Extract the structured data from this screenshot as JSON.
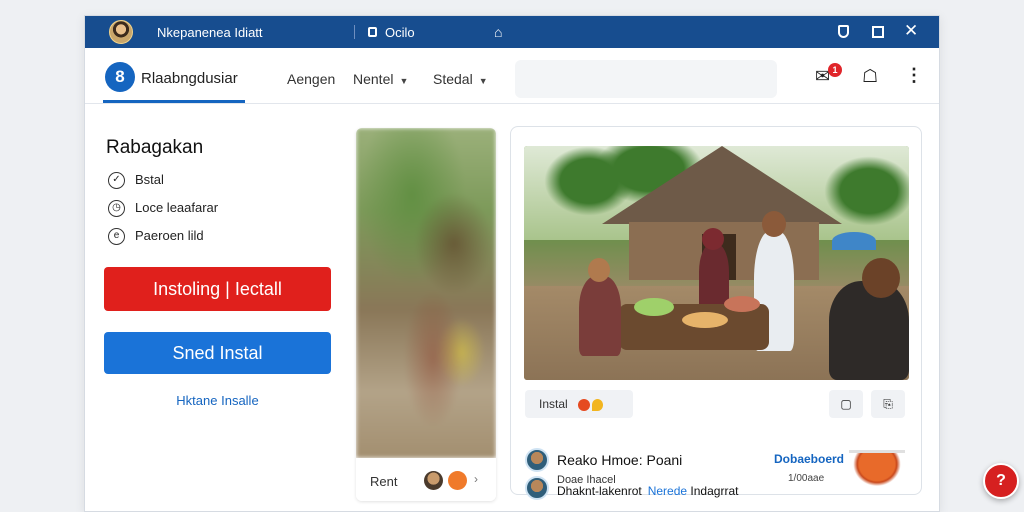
{
  "titlebar": {
    "title": "Nkepanenea Idiatt",
    "tab_label": "Ocilo",
    "icons": [
      "avatar",
      "tab-icon",
      "home-icon",
      "shield-icon",
      "maximize-icon",
      "close-icon"
    ]
  },
  "navbar": {
    "brand": "Rlaabngdusiar",
    "items": [
      {
        "label": "Aengen",
        "has_dropdown": false
      },
      {
        "label": "Nentel",
        "has_dropdown": true
      },
      {
        "label": "Stedal",
        "has_dropdown": true
      }
    ],
    "notification_count": "1",
    "icons": [
      "bell-icon",
      "profile-icon",
      "kebab-menu-icon"
    ]
  },
  "left_panel": {
    "title": "Rabagakan",
    "options": [
      {
        "label": "Bstal",
        "icon": "check-circle-icon"
      },
      {
        "label": "Loce leaafarar",
        "icon": "clock-icon"
      },
      {
        "label": "Paeroen lild",
        "icon": "info-circle-icon"
      }
    ],
    "primary_button": "Instoling | Iectall",
    "secondary_button": "Sned Instal",
    "link": "Hktane Insalle"
  },
  "middle_card": {
    "label": "Rent"
  },
  "right_card": {
    "chip_label": "Instal",
    "row1": {
      "name": "Reako Hmoe: Poani",
      "link": "Dobaeboerd"
    },
    "row2": {
      "name": "Dhaknt-lakenrot",
      "blue_text": "Nerede",
      "suffix": "Indagrrat",
      "small": "Doae Ihacel",
      "meta": "1/00aae"
    }
  },
  "colors": {
    "titlebar": "#174d8f",
    "accent_blue": "#1a73d8",
    "accent_red": "#e0201c",
    "fab": "#d62020"
  }
}
